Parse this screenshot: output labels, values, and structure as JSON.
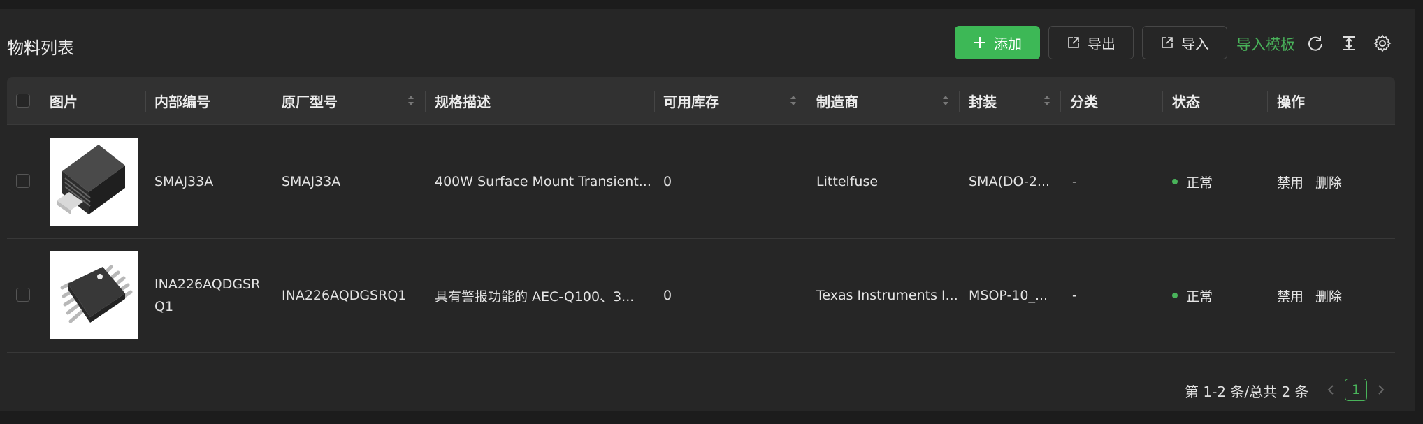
{
  "page": {
    "title": "物料列表"
  },
  "toolbar": {
    "add_label": "添加",
    "export_label": "导出",
    "import_label": "导入",
    "template_label": "导入模板",
    "icons": [
      "refresh-icon",
      "column-height-icon",
      "settings-icon"
    ]
  },
  "table": {
    "columns": [
      "图片",
      "内部编号",
      "原厂型号",
      "规格描述",
      "可用库存",
      "制造商",
      "封装",
      "分类",
      "状态",
      "操作"
    ],
    "rows": [
      {
        "image": "smd-diode-package-image",
        "internal_no": "SMAJ33A",
        "mfr_part": "SMAJ33A",
        "description": "400W Surface Mount Transient...",
        "stock": "0",
        "manufacturer": "Littelfuse",
        "package": "SMA(DO-2...",
        "category": "-",
        "status": "正常",
        "action_disable": "禁用",
        "action_delete": "删除"
      },
      {
        "image": "msop-ic-package-image",
        "internal_no_line1": "INA226AQDGSR",
        "internal_no_line2": "Q1",
        "mfr_part": "INA226AQDGSRQ1",
        "description": "具有警报功能的 AEC-Q100、3...",
        "stock": "0",
        "manufacturer": "Texas Instruments I...",
        "package": "MSOP-10_...",
        "category": "-",
        "status": "正常",
        "action_disable": "禁用",
        "action_delete": "删除"
      }
    ]
  },
  "pagination": {
    "summary": "第 1-2 条/总共 2 条",
    "current_page": "1"
  },
  "colors": {
    "accent": "#3db856",
    "danger": "#e0483f",
    "background": "#262626",
    "header_bg": "#313131"
  }
}
